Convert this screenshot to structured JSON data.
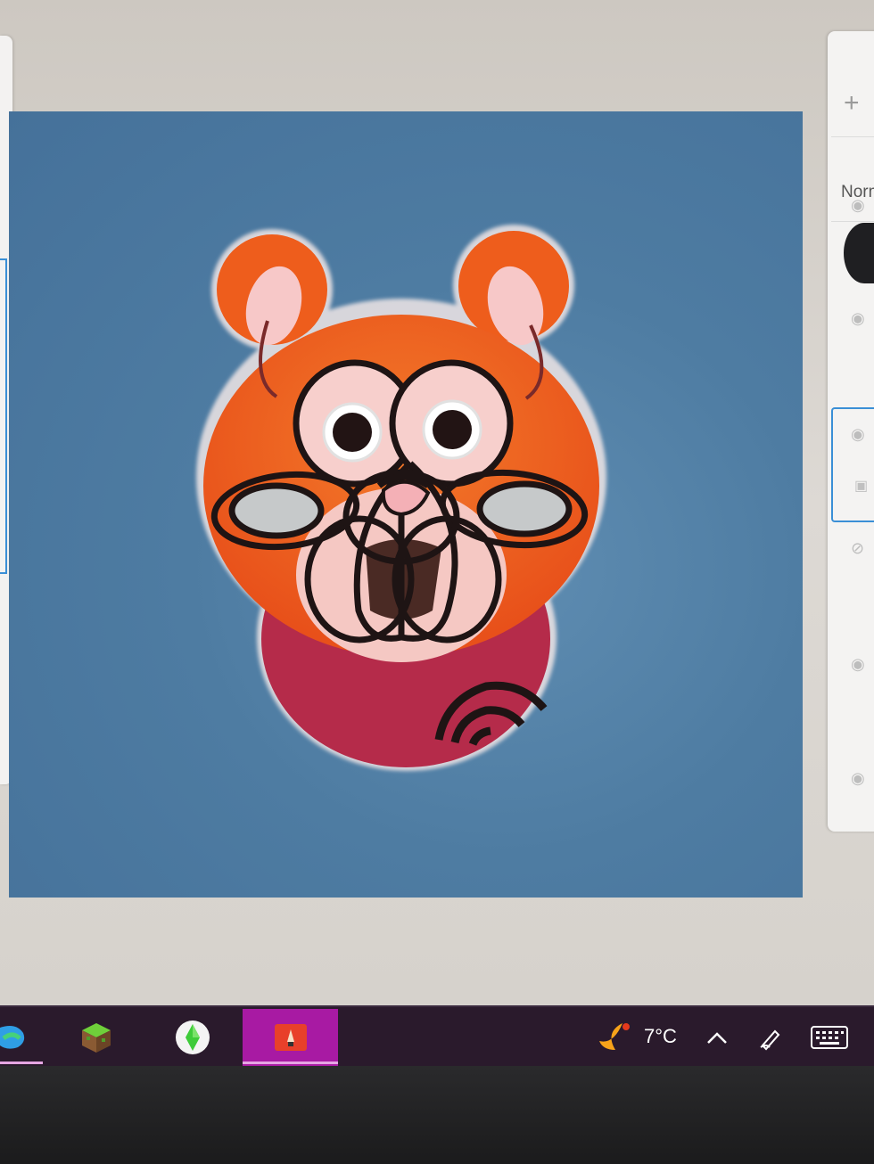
{
  "layers_panel": {
    "add_label": "+",
    "blend_mode": "Normal"
  },
  "taskbar": {
    "weather_temp": "7°C",
    "tray_chevron": "^"
  },
  "colors": {
    "canvas_bg": "#4e7ca2",
    "bear_orange": "#f2611c",
    "bear_body": "#b52b4a",
    "taskbar_bg": "#2a1a2c",
    "active_app": "#a81aa3",
    "selection_blue": "#3a8fd6"
  },
  "icons": {
    "edge": "edge-icon",
    "minecraft": "minecraft-icon",
    "sims": "sims-plumbob-icon",
    "drawing_app": "drawing-app-icon",
    "weather": "moon-weather-icon",
    "pen": "pen-icon",
    "keyboard": "keyboard-icon"
  }
}
